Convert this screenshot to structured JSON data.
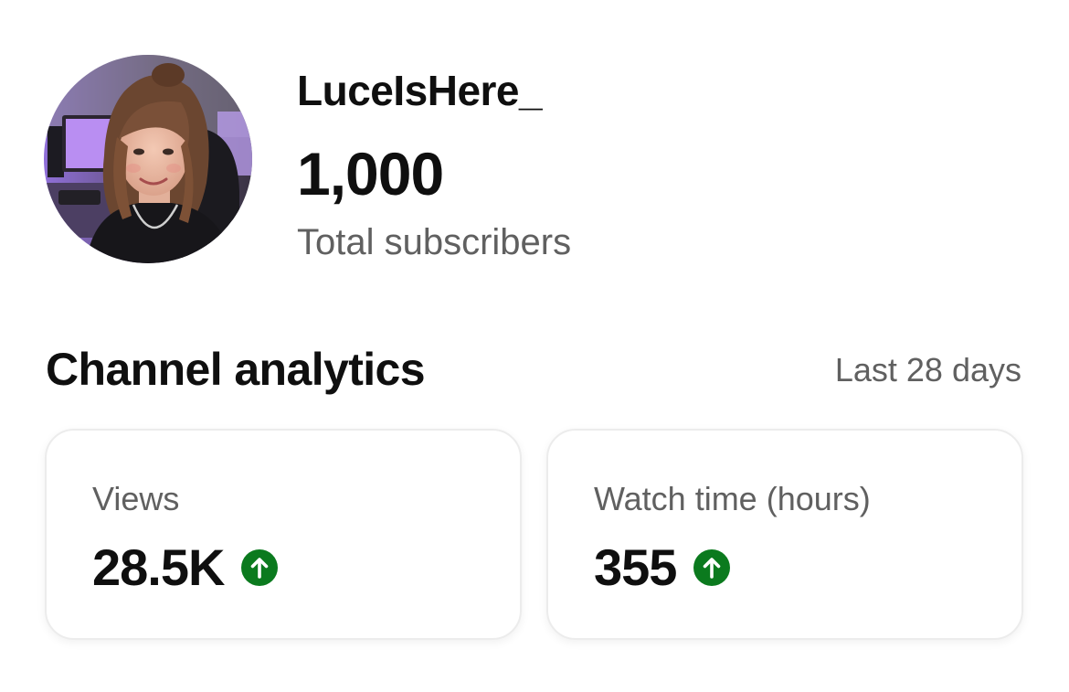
{
  "profile": {
    "channel_name": "LuceIsHere_",
    "subscriber_count": "1,000",
    "subscriber_label": "Total subscribers"
  },
  "analytics": {
    "title": "Channel analytics",
    "range": "Last 28 days",
    "cards": [
      {
        "label": "Views",
        "value": "28.5K",
        "trend": "up"
      },
      {
        "label": "Watch time (hours)",
        "value": "355",
        "trend": "up"
      }
    ]
  },
  "colors": {
    "text_primary": "#0f0f0f",
    "text_secondary": "#606060",
    "trend_up": "#0b7a1e",
    "card_border": "#ececec"
  },
  "icons": {
    "trend_up": "arrow-up-circle-icon"
  }
}
